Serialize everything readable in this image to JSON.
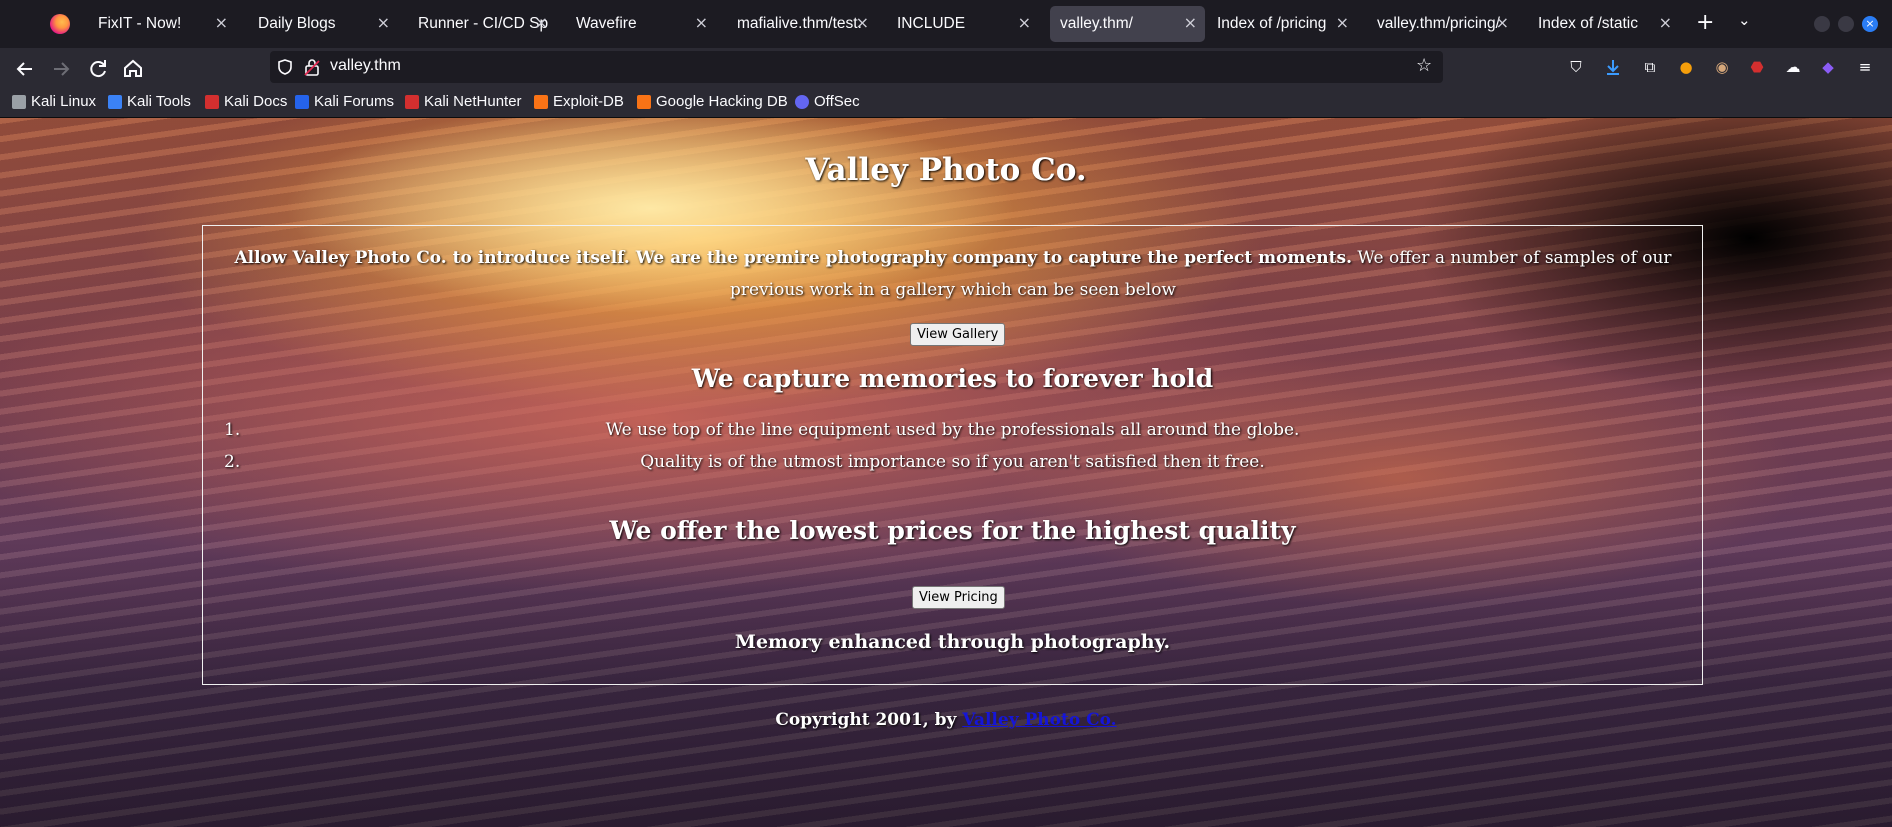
{
  "tabs": [
    {
      "title": "FixIT - Now!",
      "active": false
    },
    {
      "title": "Daily Blogs",
      "active": false
    },
    {
      "title": "Runner - CI/CD Spe",
      "active": false
    },
    {
      "title": "Wavefire",
      "active": false
    },
    {
      "title": "mafialive.thm/test.",
      "active": false
    },
    {
      "title": "INCLUDE",
      "active": false
    },
    {
      "title": "valley.thm/",
      "active": true
    },
    {
      "title": "Index of /pricing",
      "active": false
    },
    {
      "title": "valley.thm/pricing/",
      "active": false
    },
    {
      "title": "Index of /static",
      "active": false
    }
  ],
  "tab_close_glyph": "×",
  "new_tab_glyph": "+",
  "tab_list_glyph": "⌄",
  "url": "valley.thm",
  "bookmarks": [
    {
      "label": "Kali Linux",
      "icon": "kali-dragon-icon",
      "color": "#9aa0a6"
    },
    {
      "label": "Kali Tools",
      "icon": "kali-tools-icon",
      "color": "#3b82f6"
    },
    {
      "label": "Kali Docs",
      "icon": "kali-docs-icon",
      "color": "#d32f2f"
    },
    {
      "label": "Kali Forums",
      "icon": "kali-forums-icon",
      "color": "#2563eb"
    },
    {
      "label": "Kali NetHunter",
      "icon": "nethunter-icon",
      "color": "#d32f2f"
    },
    {
      "label": "Exploit-DB",
      "icon": "exploit-db-icon",
      "color": "#f97316"
    },
    {
      "label": "Google Hacking DB",
      "icon": "ghdb-icon",
      "color": "#f97316"
    },
    {
      "label": "OffSec",
      "icon": "offsec-icon",
      "color": "#6366f1"
    }
  ],
  "page": {
    "title": "Valley Photo Co.",
    "intro_bold": "Allow Valley Photo Co. to introduce itself. We are the premire photography company to capture the perfect moments.",
    "intro_rest": " We offer a number of samples of our previous work in a gallery which can be seen below",
    "gallery_button": "View Gallery",
    "heading1": "We capture memories to forever hold",
    "list": [
      {
        "num": "1.",
        "text": "We use top of the line equipment used by the professionals all around the globe."
      },
      {
        "num": "2.",
        "text": "Quality is of the utmost importance so if you aren't satisfied then it free."
      }
    ],
    "heading2": "We offer the lowest prices for the highest quality",
    "pricing_button": "View Pricing",
    "tagline": "Memory enhanced through photography.",
    "footer_prefix": "Copyright 2001, by ",
    "footer_link": "Valley Photo Co."
  },
  "colors": {
    "link": "#1515d8",
    "active_tab": "#42414d",
    "toolbar": "#2b2a33"
  }
}
